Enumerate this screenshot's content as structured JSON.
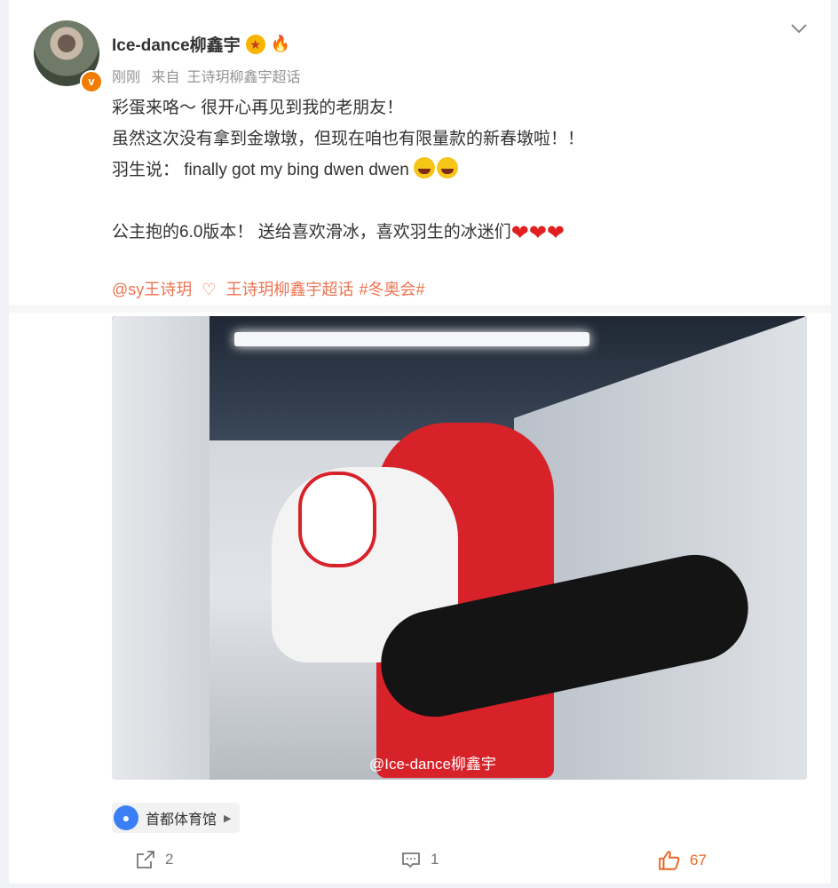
{
  "user": {
    "name": "Ice-dance柳鑫宇",
    "badge": "v",
    "time": "刚刚",
    "source_prefix": "来自",
    "source": "王诗玥柳鑫宇超话"
  },
  "post": {
    "lines": [
      "彩蛋来咯～ 很开心再见到我的老朋友！",
      "虽然这次没有拿到金墩墩，但现在咱也有限量款的新春墩啦！！",
      "羽生说： finally got my bing dwen dwen",
      "",
      "公主抱的6.0版本！ 送给喜欢滑冰，喜欢羽生的冰迷们"
    ],
    "mention": "@sy王诗玥",
    "supertopic": "王诗玥柳鑫宇超话",
    "hashtag": "#冬奥会#"
  },
  "photo": {
    "watermark": "@Ice-dance柳鑫宇"
  },
  "location": {
    "name": "首都体育馆"
  },
  "actions": {
    "repost_count": "2",
    "comment_count": "1",
    "like_count": "67"
  },
  "colors": {
    "link": "#eb7350",
    "like": "#e86722",
    "location_pin": "#3a7ff6"
  }
}
